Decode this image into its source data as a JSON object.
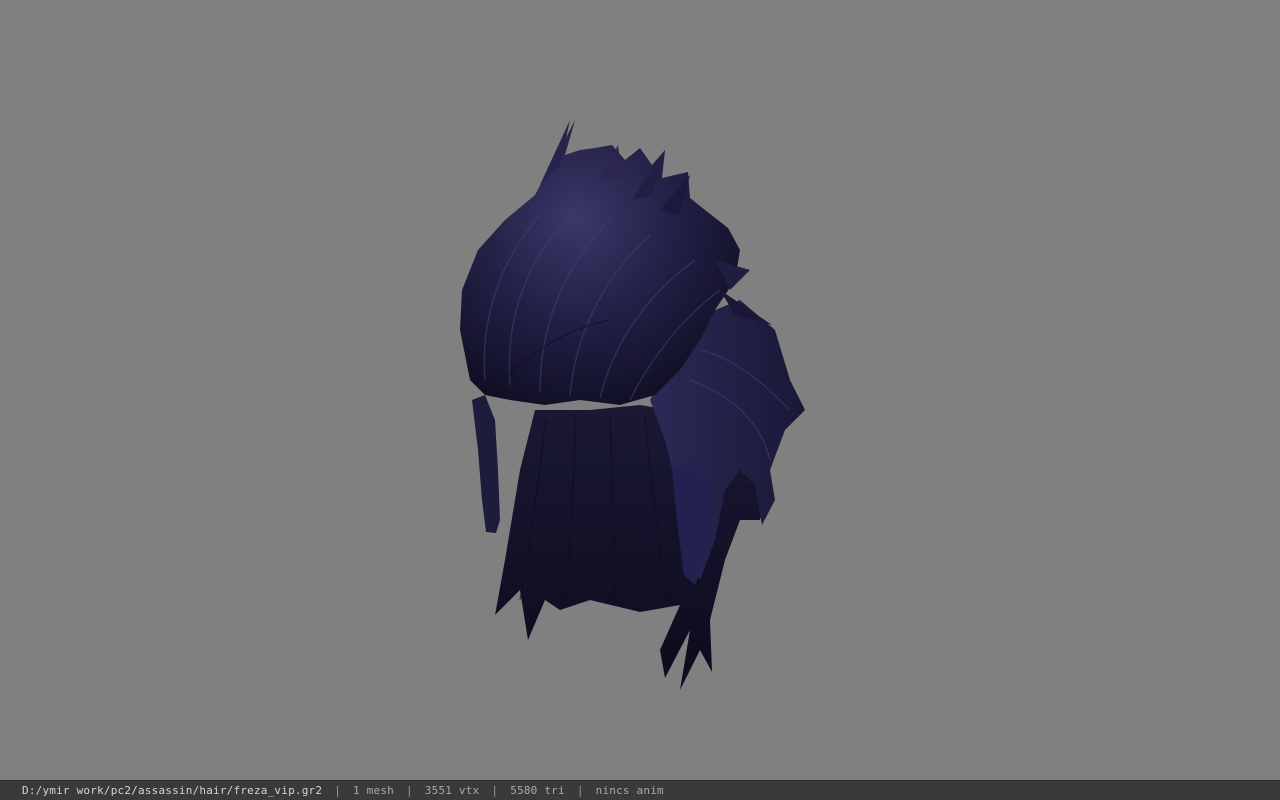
{
  "viewport": {
    "background_color": "#808080",
    "model_name": "freza_vip",
    "model_color": "#1f1d3e"
  },
  "status_bar": {
    "file_path": "D:/ymir work/pc2/assassin/hair/freza_vip.gr2",
    "separator": "|",
    "mesh_count": "1 mesh",
    "vertex_count": "3551 vtx",
    "triangle_count": "5580 tri",
    "animation_status": "nincs anim"
  }
}
